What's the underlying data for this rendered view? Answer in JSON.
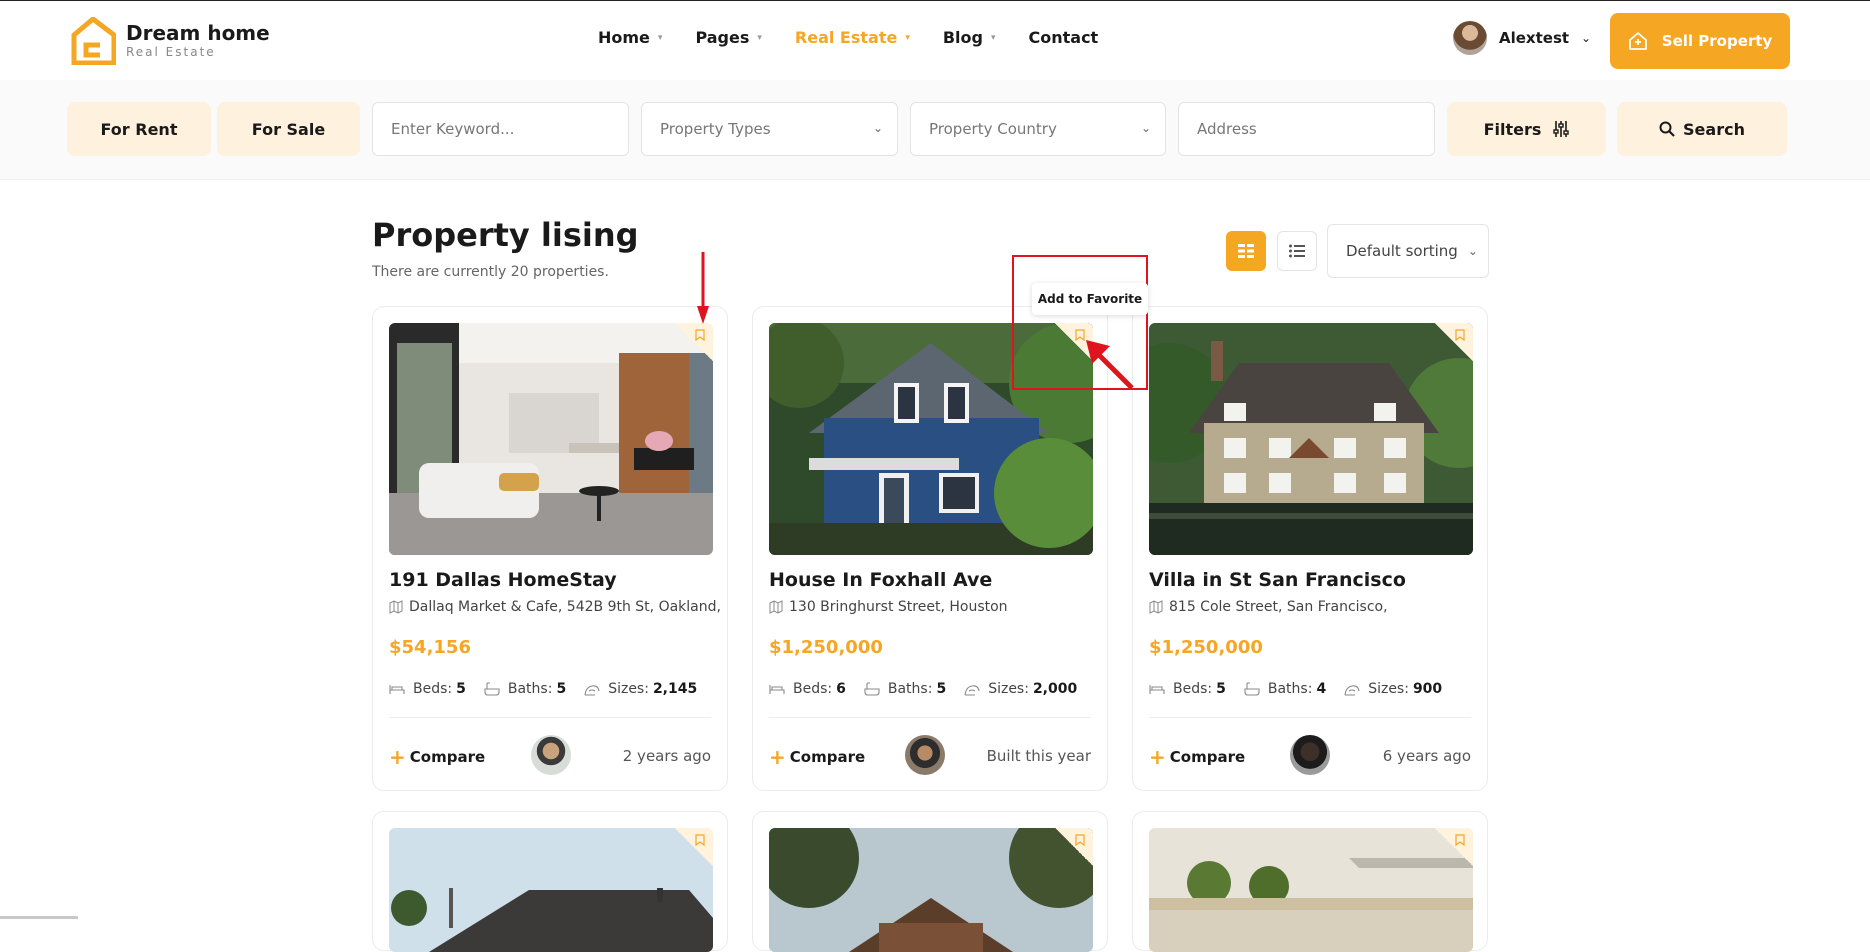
{
  "brand": {
    "title": "Dream home",
    "subtitle": "Real Estate",
    "accent": "#f5a623"
  },
  "nav": [
    {
      "label": "Home",
      "has_dropdown": true,
      "active": false
    },
    {
      "label": "Pages",
      "has_dropdown": true,
      "active": false
    },
    {
      "label": "Real Estate",
      "has_dropdown": true,
      "active": true
    },
    {
      "label": "Blog",
      "has_dropdown": true,
      "active": false
    },
    {
      "label": "Contact",
      "has_dropdown": false,
      "active": false
    }
  ],
  "user": {
    "name": "Alextest"
  },
  "sell_button": {
    "label": "Sell Property",
    "icon": "house-icon"
  },
  "search": {
    "for_rent": "For Rent",
    "for_sale": "For Sale",
    "keyword_placeholder": "Enter Keyword...",
    "property_types": "Property Types",
    "property_country": "Property Country",
    "address_placeholder": "Address",
    "filters_label": "Filters",
    "search_label": "Search"
  },
  "listing": {
    "title": "Property lising",
    "subtitle": "There are currently 20 properties.",
    "sort_label": "Default sorting"
  },
  "tooltip": "Add to Favorite",
  "cards": [
    {
      "title": "191 Dallas HomeStay",
      "address": "Dallaq Market & Cafe, 542B 9th St, Oakland,",
      "price": "$54,156",
      "beds_label": "Beds:",
      "beds": "5",
      "baths_label": "Baths:",
      "baths": "5",
      "sizes_label": "Sizes:",
      "sizes": "2,145",
      "compare": "Compare",
      "ago": "2 years ago"
    },
    {
      "title": "House In Foxhall Ave",
      "address": "130 Bringhurst Street, Houston",
      "price": "$1,250,000",
      "beds_label": "Beds:",
      "beds": "6",
      "baths_label": "Baths:",
      "baths": "5",
      "sizes_label": "Sizes:",
      "sizes": "2,000",
      "compare": "Compare",
      "ago": "Built this year"
    },
    {
      "title": "Villa in St San Francisco",
      "address": "815 Cole Street, San Francisco,",
      "price": "$1,250,000",
      "beds_label": "Beds:",
      "beds": "5",
      "baths_label": "Baths:",
      "baths": "4",
      "sizes_label": "Sizes:",
      "sizes": "900",
      "compare": "Compare",
      "ago": "6 years ago"
    }
  ]
}
